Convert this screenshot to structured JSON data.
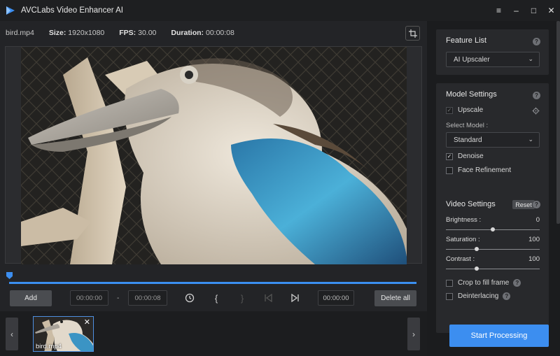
{
  "app": {
    "title": "AVCLabs Video Enhancer AI",
    "window_controls": [
      "≡",
      "–",
      "□",
      "✕"
    ]
  },
  "info": {
    "filename": "bird.mp4",
    "size_label": "Size:",
    "size_value": "1920x1080",
    "fps_label": "FPS:",
    "fps_value": "30.00",
    "duration_label": "Duration:",
    "duration_value": "00:00:08"
  },
  "timeline": {
    "progress_fraction": 1.0
  },
  "controls": {
    "add_label": "Add",
    "start_time": "00:00:00",
    "end_time": "00:00:08",
    "separator": "-",
    "current_time": "00:00:00",
    "delete_all_label": "Delete all",
    "mark_in_symbol": "{",
    "mark_out_symbol": "}"
  },
  "thumbnail": {
    "label": "bird.mp4",
    "close_symbol": "✕"
  },
  "nav": {
    "prev_symbol": "‹",
    "next_symbol": "›"
  },
  "feature_list": {
    "title": "Feature List",
    "help": "?",
    "selected": "AI Upscaler",
    "chevron": "⌄"
  },
  "model_settings": {
    "title": "Model Settings",
    "help": "?",
    "upscale_label": "Upscale",
    "select_model_label": "Select Model :",
    "model_selected": "Standard",
    "chevron": "⌄",
    "denoise_label": "Denoise",
    "face_refinement_label": "Face Refinement",
    "check_mark": "✓"
  },
  "video_settings": {
    "title": "Video Settings",
    "reset_label": "Reset",
    "help": "?",
    "brightness_label": "Brightness :",
    "brightness_value": "0",
    "saturation_label": "Saturation :",
    "saturation_value": "100",
    "contrast_label": "Contrast :",
    "contrast_value": "100",
    "crop_label": "Crop to fill frame",
    "deinterlacing_label": "Deinterlacing"
  },
  "start_processing_label": "Start Processing",
  "colors": {
    "accent": "#3c8ef0",
    "panel": "#28292c",
    "background": "#1b1c1e"
  }
}
